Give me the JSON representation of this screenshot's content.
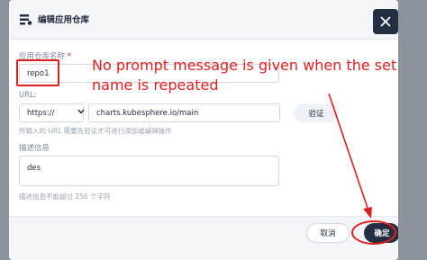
{
  "dialog": {
    "title": "编辑应用仓库",
    "name_label": "应用仓库名称",
    "required_mark": "*",
    "name_value": "repo1",
    "url_label": "URL:",
    "protocol_value": "https://",
    "url_value": "charts.kubesphere.io/main",
    "verify_label": "验证",
    "url_hint": "所输入的 URL 需要先验证才可进行添加或编辑操作",
    "desc_label": "描述信息",
    "desc_value": "des",
    "desc_hint": "描述信息不能超过 256 个字符",
    "cancel_label": "取消",
    "ok_label": "确定"
  },
  "annotation": {
    "text": "No prompt message is given when the set name is repeated",
    "color": "#e02020"
  },
  "colors": {
    "dark": "#242e42",
    "backdrop": "#8d939c",
    "header_bg": "#f3f5f8"
  }
}
